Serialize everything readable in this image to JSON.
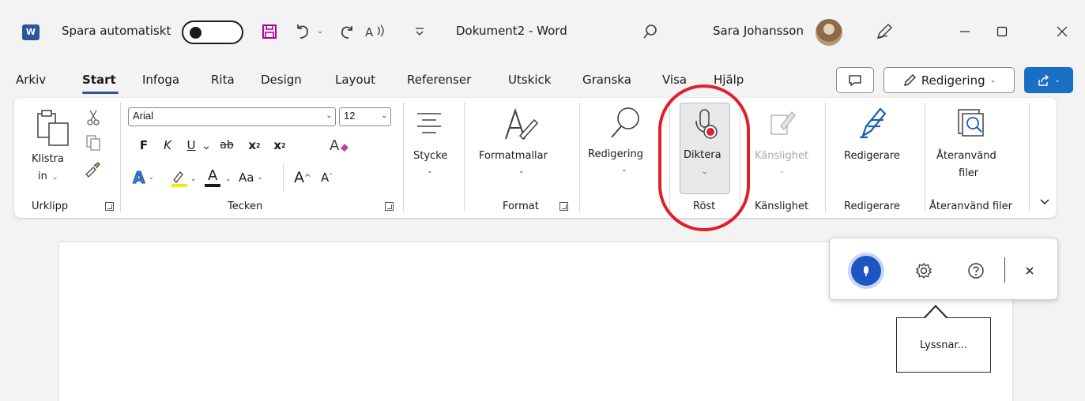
{
  "titlebar": {
    "app_logo": "W",
    "autosave_label": "Spara automatiskt",
    "document_title": "Dokument2  -  Word",
    "user_name": "Sara Johansson"
  },
  "tabs": [
    {
      "label": "Arkiv"
    },
    {
      "label": "Start",
      "active": true
    },
    {
      "label": "Infoga"
    },
    {
      "label": "Rita"
    },
    {
      "label": "Design"
    },
    {
      "label": "Layout"
    },
    {
      "label": "Referenser"
    },
    {
      "label": "Utskick"
    },
    {
      "label": "Granska"
    },
    {
      "label": "Visa"
    },
    {
      "label": "Hjälp"
    }
  ],
  "header_actions": {
    "editing_mode_label": "Redigering"
  },
  "ribbon": {
    "clipboard": {
      "paste_line1": "Klistra",
      "paste_line2": "in",
      "group_label": "Urklipp"
    },
    "font": {
      "font_name": "Arial",
      "font_size": "12",
      "bold": "F",
      "italic": "K",
      "underline": "U",
      "strikethrough": "ab",
      "subscript": "x",
      "superscript": "x",
      "text_effects": "A",
      "font_color": "A",
      "change_case": "Aa",
      "grow_font": "A",
      "shrink_font": "A",
      "group_label": "Tecken"
    },
    "paragraph": {
      "label": "Stycke"
    },
    "styles": {
      "label": "Formatmallar",
      "group_label": "Format"
    },
    "editing": {
      "label": "Redigering"
    },
    "voice": {
      "dictate_label": "Diktera",
      "group_label": "Röst"
    },
    "sensitivity": {
      "label": "Känslighet",
      "group_label": "Känslighet"
    },
    "editor": {
      "label": "Redigerare",
      "group_label": "Redigerare"
    },
    "reuse": {
      "label_line1": "Återanvänd",
      "label_line2": "filer",
      "group_label": "Återanvänd filer"
    }
  },
  "dictation": {
    "tooltip": "Lyssnar..."
  },
  "colors": {
    "word_blue": "#2b579a",
    "share_blue": "#1a6fc4",
    "mic_blue": "#1d56c2",
    "record_red": "#e01f2d",
    "highlight_yellow": "#ffe600"
  },
  "icons": [
    "word-logo-icon",
    "save-icon",
    "undo-icon",
    "redo-icon",
    "read-aloud-icon",
    "customize-qat-icon",
    "search-icon",
    "pen-icon",
    "minimize-icon",
    "maximize-icon",
    "close-icon",
    "comments-icon",
    "share-icon",
    "paste-icon",
    "cut-icon",
    "copy-icon",
    "format-painter-icon",
    "clear-formatting-icon",
    "paragraph-icon",
    "styles-icon",
    "find-icon",
    "dictate-icon",
    "sensitivity-icon",
    "editor-icon",
    "reuse-files-icon",
    "microphone-icon",
    "settings-icon",
    "help-icon"
  ]
}
